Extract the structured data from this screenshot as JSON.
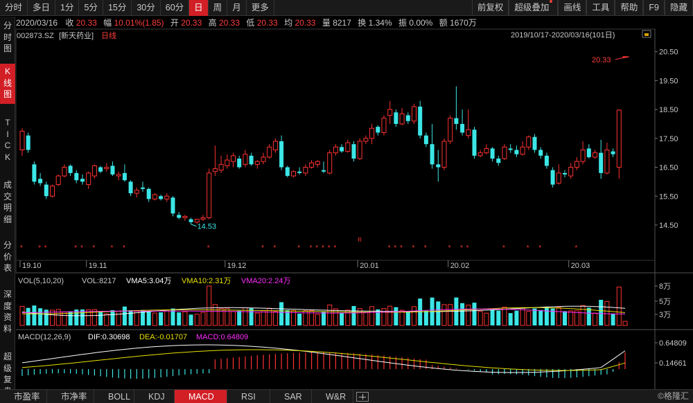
{
  "toolbar": {
    "left": [
      "分时",
      "多日",
      "1分",
      "5分",
      "15分",
      "30分",
      "60分",
      "日",
      "周",
      "月",
      "更多"
    ],
    "active": "日",
    "right": [
      "前复权",
      "超级叠加",
      "画线",
      "工具",
      "帮助",
      "F9",
      "隐藏"
    ]
  },
  "left_nav": [
    {
      "label": "分\n时\n图",
      "active": false
    },
    {
      "label": "K\n线\n图",
      "active": true
    },
    {
      "label": "T\nI\nC\nK",
      "active": false
    },
    {
      "label": "成\n交\n明\n细",
      "active": false
    },
    {
      "label": "分\n价\n表",
      "active": false
    },
    {
      "label": "深\n度\n资\n料",
      "active": false
    },
    {
      "label": "超\n级\n复\n盘",
      "active": false
    }
  ],
  "quote": {
    "date": "2020/03/16",
    "close_label": "收",
    "close": "20.33",
    "change_label": "幅",
    "change": "10.01%(1.85)",
    "open_label": "开",
    "open": "20.33",
    "high_label": "高",
    "high": "20.33",
    "low_label": "低",
    "low": "20.33",
    "avg_label": "均",
    "avg": "20.33",
    "volume_label": "量",
    "volume": "8217",
    "turnover_label": "换",
    "turnover": "1.34%",
    "amplitude_label": "振",
    "amplitude": "0.00%",
    "amount_label": "额",
    "amount": "1670万"
  },
  "chart_header": {
    "code": "002873.SZ",
    "name": "[新天药业]",
    "period": "日线",
    "range": "2019/10/17-2020/03/16(101日)"
  },
  "colors": {
    "up": "#ff3232",
    "down": "#3ce6e6",
    "accent": "#d21f26",
    "ma5": "#ffffff",
    "ma10": "#e8e000",
    "ma20": "#ff2cff"
  },
  "chart_data": [
    {
      "type": "candlestick",
      "y_ticks": [
        "20.50",
        "19.50",
        "18.50",
        "17.50",
        "16.50",
        "15.50",
        "14.50"
      ],
      "ylim": [
        13.9,
        20.9
      ],
      "x_labels": [
        "19.10",
        "19.11",
        "19.12",
        "20.01",
        "20.02",
        "20.03"
      ],
      "annotations": {
        "max": "20.33",
        "min": "14.53"
      },
      "candles": [
        {
          "o": 17.1,
          "h": 17.85,
          "l": 16.9,
          "c": 17.75
        },
        {
          "o": 17.6,
          "h": 17.7,
          "l": 17.0,
          "c": 17.1
        },
        {
          "o": 16.6,
          "h": 16.7,
          "l": 15.9,
          "c": 16.0
        },
        {
          "o": 16.1,
          "h": 16.3,
          "l": 15.85,
          "c": 15.95
        },
        {
          "o": 15.9,
          "h": 16.0,
          "l": 15.4,
          "c": 15.5
        },
        {
          "o": 15.5,
          "h": 15.9,
          "l": 15.45,
          "c": 15.85
        },
        {
          "o": 15.9,
          "h": 16.25,
          "l": 15.85,
          "c": 16.2
        },
        {
          "o": 16.2,
          "h": 16.6,
          "l": 16.15,
          "c": 16.5
        },
        {
          "o": 16.55,
          "h": 16.6,
          "l": 16.2,
          "c": 16.3
        },
        {
          "o": 16.3,
          "h": 16.4,
          "l": 15.95,
          "c": 16.05
        },
        {
          "o": 16.1,
          "h": 16.25,
          "l": 15.9,
          "c": 16.0
        },
        {
          "o": 15.9,
          "h": 16.35,
          "l": 15.75,
          "c": 16.3
        },
        {
          "o": 16.2,
          "h": 16.6,
          "l": 16.1,
          "c": 16.55
        },
        {
          "o": 16.5,
          "h": 16.55,
          "l": 16.3,
          "c": 16.35
        },
        {
          "o": 16.45,
          "h": 16.65,
          "l": 16.35,
          "c": 16.5
        },
        {
          "o": 16.55,
          "h": 16.7,
          "l": 16.2,
          "c": 16.25
        },
        {
          "o": 16.2,
          "h": 16.35,
          "l": 16.05,
          "c": 16.25
        },
        {
          "o": 16.3,
          "h": 16.6,
          "l": 16.0,
          "c": 16.05
        },
        {
          "o": 16.0,
          "h": 16.05,
          "l": 15.5,
          "c": 15.6
        },
        {
          "o": 15.6,
          "h": 15.8,
          "l": 15.45,
          "c": 15.7
        },
        {
          "o": 15.8,
          "h": 16.0,
          "l": 15.65,
          "c": 15.75
        },
        {
          "o": 15.75,
          "h": 15.8,
          "l": 15.3,
          "c": 15.4
        },
        {
          "o": 15.4,
          "h": 15.6,
          "l": 15.35,
          "c": 15.55
        },
        {
          "o": 15.5,
          "h": 15.55,
          "l": 15.35,
          "c": 15.4
        },
        {
          "o": 15.4,
          "h": 15.6,
          "l": 15.3,
          "c": 15.5
        },
        {
          "o": 15.45,
          "h": 15.5,
          "l": 14.8,
          "c": 14.9
        },
        {
          "o": 14.85,
          "h": 14.95,
          "l": 14.7,
          "c": 14.75
        },
        {
          "o": 14.75,
          "h": 14.85,
          "l": 14.65,
          "c": 14.8
        },
        {
          "o": 14.7,
          "h": 14.75,
          "l": 14.53,
          "c": 14.6
        },
        {
          "o": 14.6,
          "h": 14.7,
          "l": 14.55,
          "c": 14.7
        },
        {
          "o": 14.7,
          "h": 14.85,
          "l": 14.65,
          "c": 14.75
        },
        {
          "o": 14.75,
          "h": 16.45,
          "l": 14.7,
          "c": 16.3
        },
        {
          "o": 16.35,
          "h": 17.25,
          "l": 16.2,
          "c": 16.45
        },
        {
          "o": 16.4,
          "h": 16.9,
          "l": 16.3,
          "c": 16.6
        },
        {
          "o": 16.55,
          "h": 16.95,
          "l": 16.45,
          "c": 16.75
        },
        {
          "o": 16.7,
          "h": 17.0,
          "l": 16.5,
          "c": 16.9
        },
        {
          "o": 16.8,
          "h": 16.9,
          "l": 16.45,
          "c": 16.5
        },
        {
          "o": 16.6,
          "h": 17.1,
          "l": 16.5,
          "c": 16.95
        },
        {
          "o": 16.9,
          "h": 17.0,
          "l": 16.55,
          "c": 16.6
        },
        {
          "o": 16.6,
          "h": 16.75,
          "l": 16.45,
          "c": 16.7
        },
        {
          "o": 16.7,
          "h": 17.0,
          "l": 16.6,
          "c": 16.85
        },
        {
          "o": 16.85,
          "h": 17.3,
          "l": 16.8,
          "c": 17.2
        },
        {
          "o": 17.1,
          "h": 17.5,
          "l": 17.0,
          "c": 17.4
        },
        {
          "o": 17.4,
          "h": 17.6,
          "l": 16.4,
          "c": 16.5
        },
        {
          "o": 16.5,
          "h": 16.55,
          "l": 16.15,
          "c": 16.2
        },
        {
          "o": 16.2,
          "h": 16.4,
          "l": 16.15,
          "c": 16.35
        },
        {
          "o": 16.35,
          "h": 16.5,
          "l": 16.25,
          "c": 16.3
        },
        {
          "o": 16.3,
          "h": 16.6,
          "l": 16.2,
          "c": 16.5
        },
        {
          "o": 16.5,
          "h": 16.75,
          "l": 16.45,
          "c": 16.65
        },
        {
          "o": 16.6,
          "h": 16.75,
          "l": 16.5,
          "c": 16.7
        },
        {
          "o": 16.4,
          "h": 16.7,
          "l": 16.3,
          "c": 16.35
        },
        {
          "o": 16.3,
          "h": 17.1,
          "l": 16.25,
          "c": 17.0
        },
        {
          "o": 17.0,
          "h": 17.3,
          "l": 16.9,
          "c": 17.2
        },
        {
          "o": 17.2,
          "h": 17.3,
          "l": 17.0,
          "c": 17.05
        },
        {
          "o": 17.05,
          "h": 17.45,
          "l": 17.0,
          "c": 17.35
        },
        {
          "o": 17.3,
          "h": 17.4,
          "l": 16.7,
          "c": 16.8
        },
        {
          "o": 16.8,
          "h": 17.5,
          "l": 16.75,
          "c": 17.4
        },
        {
          "o": 17.4,
          "h": 17.6,
          "l": 17.3,
          "c": 17.5
        },
        {
          "o": 17.5,
          "h": 18.0,
          "l": 17.3,
          "c": 17.85
        },
        {
          "o": 17.9,
          "h": 17.95,
          "l": 17.6,
          "c": 17.7
        },
        {
          "o": 17.7,
          "h": 18.3,
          "l": 17.6,
          "c": 18.2
        },
        {
          "o": 18.3,
          "h": 18.8,
          "l": 18.0,
          "c": 18.5
        },
        {
          "o": 18.4,
          "h": 18.5,
          "l": 17.9,
          "c": 18.0
        },
        {
          "o": 18.0,
          "h": 18.55,
          "l": 17.95,
          "c": 18.35
        },
        {
          "o": 18.3,
          "h": 18.4,
          "l": 18.0,
          "c": 18.1
        },
        {
          "o": 18.1,
          "h": 18.7,
          "l": 18.0,
          "c": 18.6
        },
        {
          "o": 18.6,
          "h": 18.8,
          "l": 17.5,
          "c": 17.6
        },
        {
          "o": 17.6,
          "h": 17.7,
          "l": 17.2,
          "c": 17.3
        },
        {
          "o": 17.3,
          "h": 18.0,
          "l": 16.45,
          "c": 16.6
        },
        {
          "o": 16.6,
          "h": 17.1,
          "l": 16.0,
          "c": 16.5
        },
        {
          "o": 16.5,
          "h": 17.5,
          "l": 16.4,
          "c": 17.4
        },
        {
          "o": 17.4,
          "h": 18.3,
          "l": 17.3,
          "c": 18.2
        },
        {
          "o": 18.2,
          "h": 19.3,
          "l": 17.8,
          "c": 18.0
        },
        {
          "o": 18.0,
          "h": 18.5,
          "l": 17.6,
          "c": 17.7
        },
        {
          "o": 17.6,
          "h": 18.5,
          "l": 17.5,
          "c": 17.8
        },
        {
          "o": 17.8,
          "h": 17.9,
          "l": 16.8,
          "c": 16.9
        },
        {
          "o": 16.9,
          "h": 17.1,
          "l": 16.85,
          "c": 17.0
        },
        {
          "o": 17.0,
          "h": 17.3,
          "l": 16.95,
          "c": 17.15
        },
        {
          "o": 17.15,
          "h": 17.2,
          "l": 16.7,
          "c": 16.8
        },
        {
          "o": 16.8,
          "h": 16.9,
          "l": 16.55,
          "c": 16.65
        },
        {
          "o": 16.8,
          "h": 17.3,
          "l": 16.75,
          "c": 17.2
        },
        {
          "o": 17.15,
          "h": 17.3,
          "l": 17.0,
          "c": 17.1
        },
        {
          "o": 17.1,
          "h": 17.25,
          "l": 16.85,
          "c": 16.95
        },
        {
          "o": 16.95,
          "h": 17.4,
          "l": 16.9,
          "c": 17.2
        },
        {
          "o": 17.2,
          "h": 17.6,
          "l": 17.1,
          "c": 17.55
        },
        {
          "o": 17.55,
          "h": 17.65,
          "l": 17.0,
          "c": 17.1
        },
        {
          "o": 17.1,
          "h": 17.2,
          "l": 16.8,
          "c": 16.9
        },
        {
          "o": 16.9,
          "h": 17.0,
          "l": 16.45,
          "c": 16.55
        },
        {
          "o": 16.4,
          "h": 16.5,
          "l": 15.8,
          "c": 15.9
        },
        {
          "o": 15.95,
          "h": 16.6,
          "l": 15.9,
          "c": 16.3
        },
        {
          "o": 16.3,
          "h": 16.4,
          "l": 16.15,
          "c": 16.25
        },
        {
          "o": 16.2,
          "h": 16.65,
          "l": 16.1,
          "c": 16.5
        },
        {
          "o": 16.5,
          "h": 16.85,
          "l": 16.4,
          "c": 16.7
        },
        {
          "o": 16.7,
          "h": 17.4,
          "l": 16.6,
          "c": 17.1
        },
        {
          "o": 17.15,
          "h": 17.3,
          "l": 16.8,
          "c": 16.85
        },
        {
          "o": 16.85,
          "h": 17.1,
          "l": 16.8,
          "c": 17.0
        },
        {
          "o": 17.0,
          "h": 17.45,
          "l": 16.1,
          "c": 16.3
        },
        {
          "o": 16.3,
          "h": 17.35,
          "l": 16.25,
          "c": 17.1
        },
        {
          "o": 17.05,
          "h": 17.15,
          "l": 16.85,
          "c": 16.95
        },
        {
          "o": 16.5,
          "h": 18.5,
          "l": 16.1,
          "c": 18.48
        },
        {
          "o": 20.33,
          "h": 20.33,
          "l": 20.33,
          "c": 20.33
        }
      ],
      "star_marks": [
        0,
        3,
        4,
        9,
        10,
        12,
        15,
        17,
        31,
        40,
        42,
        46,
        48,
        49,
        50,
        51,
        52,
        61,
        62,
        63,
        65,
        67,
        71,
        73,
        74,
        80,
        84,
        86,
        92
      ],
      "r_mark": 56
    },
    {
      "type": "bar",
      "title": "VOL(5,10,20)",
      "labels": {
        "vol": "VOL:8217",
        "vma5": "VMA5:3.04万",
        "vma10": "VMA10:2.31万",
        "vma20": "VMA20:2.24万"
      },
      "y_ticks": [
        "8万",
        "5万",
        "3万"
      ],
      "unit": "万"
    },
    {
      "type": "bar",
      "title": "MACD(12,26,9)",
      "labels": {
        "dif": "DIF:0.30698",
        "dea": "DEA:-0.01707",
        "macd": "MACD:0.64809"
      },
      "y_ticks": [
        "0.64809",
        "0.14661"
      ]
    }
  ],
  "bottom_tabs": [
    "市盈率",
    "市净率",
    "BOLL",
    "KDJ",
    "MACD",
    "RSI",
    "SAR",
    "W&R"
  ],
  "bottom_active": "MACD",
  "watermark": "©格隆汇"
}
